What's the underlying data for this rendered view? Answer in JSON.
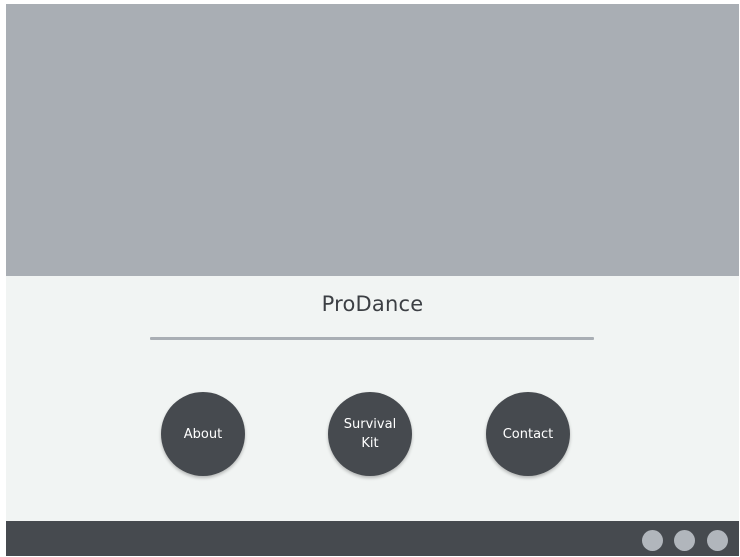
{
  "header": {
    "title": "ProDance"
  },
  "nav": {
    "buttons": [
      {
        "label": "About"
      },
      {
        "label": "Survival\nKit"
      },
      {
        "label": "Contact"
      }
    ]
  },
  "footer": {
    "dots": [
      {
        "icon": "dot-icon"
      },
      {
        "icon": "dot-icon"
      },
      {
        "icon": "dot-icon"
      }
    ]
  },
  "colors": {
    "hero": "#a9aeb4",
    "panel": "#f1f4f3",
    "dark": "#464a4f",
    "dot": "#b1b6bc"
  }
}
